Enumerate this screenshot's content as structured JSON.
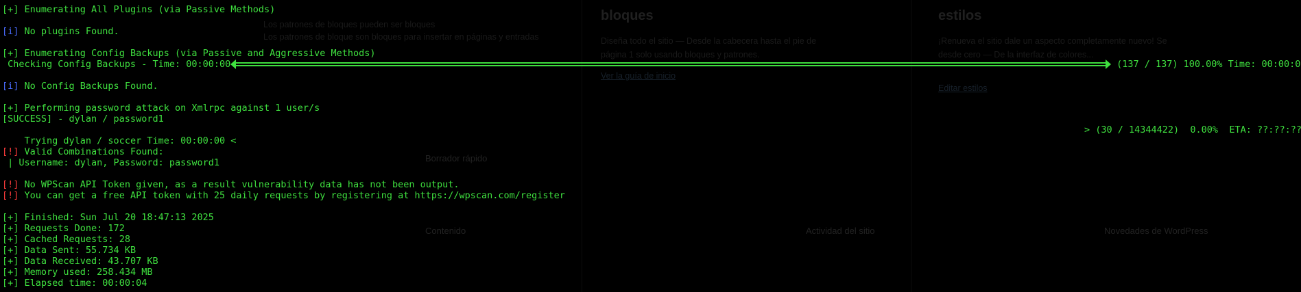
{
  "background_page": {
    "col1_text1": "Los patrones de bloques pueden ser bloques",
    "col1_text2": "Los patrones de bloque son bloques para insertar en páginas y entradas",
    "col2_heading": "bloques",
    "col2_body1": "Diseña todo el sitio — Desde la cabecera hasta el pie de",
    "col2_body2": "página 1 solo usando bloques y patrones.",
    "col2_link": "Ver la guía de inicio",
    "col3_heading": "estilos",
    "col3_body1": "¡Renueva el sitio dale un aspecto completamente nuevo! Se",
    "col3_body2": "desde cero — De la interfaz de colores...",
    "col3_link": "Editar estilos",
    "mid_label": "Borrador rápido",
    "content_label": "Contenido",
    "bottom_center": "Actividad del sitio",
    "bottom_right": "Novedades de WordPress"
  },
  "terminal": {
    "colors": {
      "text": "#3fe03f",
      "info_tag": "#4a6cff",
      "alert_tag": "#ff3b3b",
      "warn_tag": "#ff9a3c"
    },
    "lines": {
      "plugins_enum": {
        "tag": "[+]",
        "text": " Enumerating All Plugins (via Passive Methods)"
      },
      "no_plugins": {
        "tag": "[i]",
        "text": " No plugins Found."
      },
      "config_enum": {
        "tag": "[+]",
        "text": " Enumerating Config Backups (via Passive and Aggressive Methods)"
      },
      "config_progress": {
        "left": " Checking Config Backups - Time: 00:00:00 ",
        "right": " (137 / 137) 100.00% Time: 00:00:00",
        "progress_percent": 100
      },
      "no_config": {
        "tag": "[i]",
        "text": " No Config Backups Found."
      },
      "pwd_attack": {
        "tag": "[+]",
        "text": " Performing password attack on Xmlrpc against 1 user/s"
      },
      "success": "[SUCCESS] - dylan / password1",
      "trying": {
        "left": "Trying dylan / soccer Time: 00:00:00 <",
        "right": "> (30 / 14344422)  0.00%  ETA: ??:??:??"
      },
      "valid_found": {
        "tag": "[!]",
        "text": " Valid Combinations Found:"
      },
      "valid_user": " | Username: dylan, Password: password1",
      "no_token": {
        "tag": "[!]",
        "text": " No WPScan API Token given, as a result vulnerability data has not been output."
      },
      "free_token": {
        "tag": "[!]",
        "text": " You can get a free API token with 25 daily requests by registering at https://wpscan.com/register"
      },
      "finished": {
        "tag": "[+]",
        "text": " Finished: Sun Jul 20 18:47:13 2025"
      },
      "requests_done": {
        "tag": "[+]",
        "text": " Requests Done: 172"
      },
      "cached_requests": {
        "tag": "[+]",
        "text": " Cached Requests: 28"
      },
      "data_sent": {
        "tag": "[+]",
        "text": " Data Sent: 55.734 KB"
      },
      "data_received": {
        "tag": "[+]",
        "text": " Data Received: 43.707 KB"
      },
      "memory_used": {
        "tag": "[+]",
        "text": " Memory used: 258.434 MB"
      },
      "elapsed": {
        "tag": "[+]",
        "text": " Elapsed time: 00:00:04"
      }
    }
  }
}
